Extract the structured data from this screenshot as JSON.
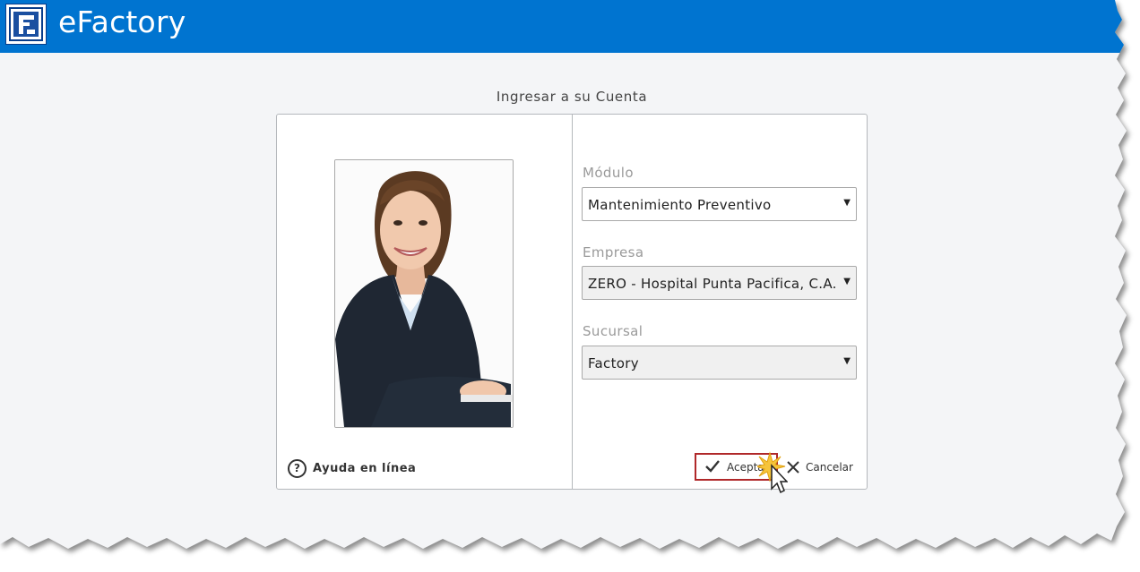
{
  "app": {
    "title": "eFactory",
    "brand_color": "#0074d0",
    "logo_icon": "efactory-f-logo"
  },
  "login": {
    "heading": "Ingresar a su Cuenta",
    "help_label": "Ayuda en línea",
    "help_icon": "question-circle-icon",
    "fields": {
      "modulo": {
        "label": "Módulo",
        "value": "Mantenimiento Preventivo"
      },
      "empresa": {
        "label": "Empresa",
        "value": "ZERO - Hospital Punta Pacifica, C.A."
      },
      "sucursal": {
        "label": "Sucursal",
        "value": "Factory"
      }
    },
    "accept_label": "Aceptar",
    "cancel_label": "Cancelar",
    "accent_highlight": "#b0282a"
  }
}
